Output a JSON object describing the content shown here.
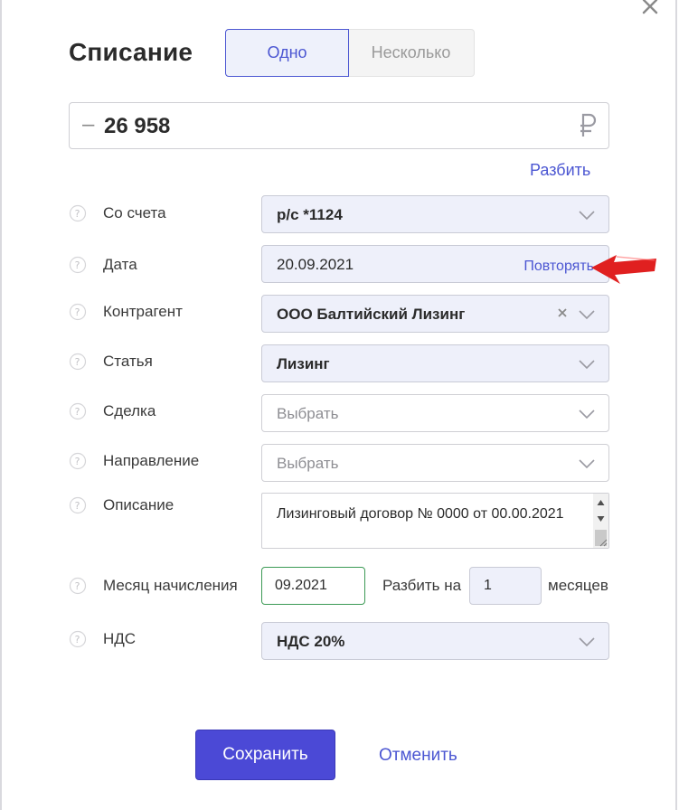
{
  "dialog": {
    "title": "Списание",
    "mode_tabs": [
      {
        "label": "Одно",
        "active": true
      },
      {
        "label": "Несколько",
        "active": false
      }
    ]
  },
  "amount": {
    "sign": "–",
    "value": "26 958",
    "currency_icon": "ruble-icon"
  },
  "split_link": "Разбить",
  "fields": {
    "account": {
      "label": "Со счета",
      "value": "р/с *1124"
    },
    "date": {
      "label": "Дата",
      "value": "20.09.2021",
      "repeat_link": "Повторять"
    },
    "counterparty": {
      "label": "Контрагент",
      "value": "ООО Балтийский Лизинг"
    },
    "category": {
      "label": "Статья",
      "value": "Лизинг"
    },
    "deal": {
      "label": "Сделка",
      "placeholder": "Выбрать"
    },
    "direction": {
      "label": "Направление",
      "placeholder": "Выбрать"
    },
    "description": {
      "label": "Описание",
      "value": "Лизинговый договор № 0000 от 00.00.2021"
    },
    "accrual_month": {
      "label": "Месяц начисления",
      "value": "09.2021",
      "split_on": "Разбить на",
      "count": "1",
      "months": "месяцев"
    },
    "vat": {
      "label": "НДС",
      "value": "НДС 20%"
    }
  },
  "actions": {
    "save": "Сохранить",
    "cancel": "Отменить"
  },
  "colors": {
    "accent": "#4b56d2",
    "button": "#4b49d6",
    "field_bg": "#eef0fa",
    "focus_border": "#3c9a55",
    "annotation_arrow": "#e02020"
  }
}
